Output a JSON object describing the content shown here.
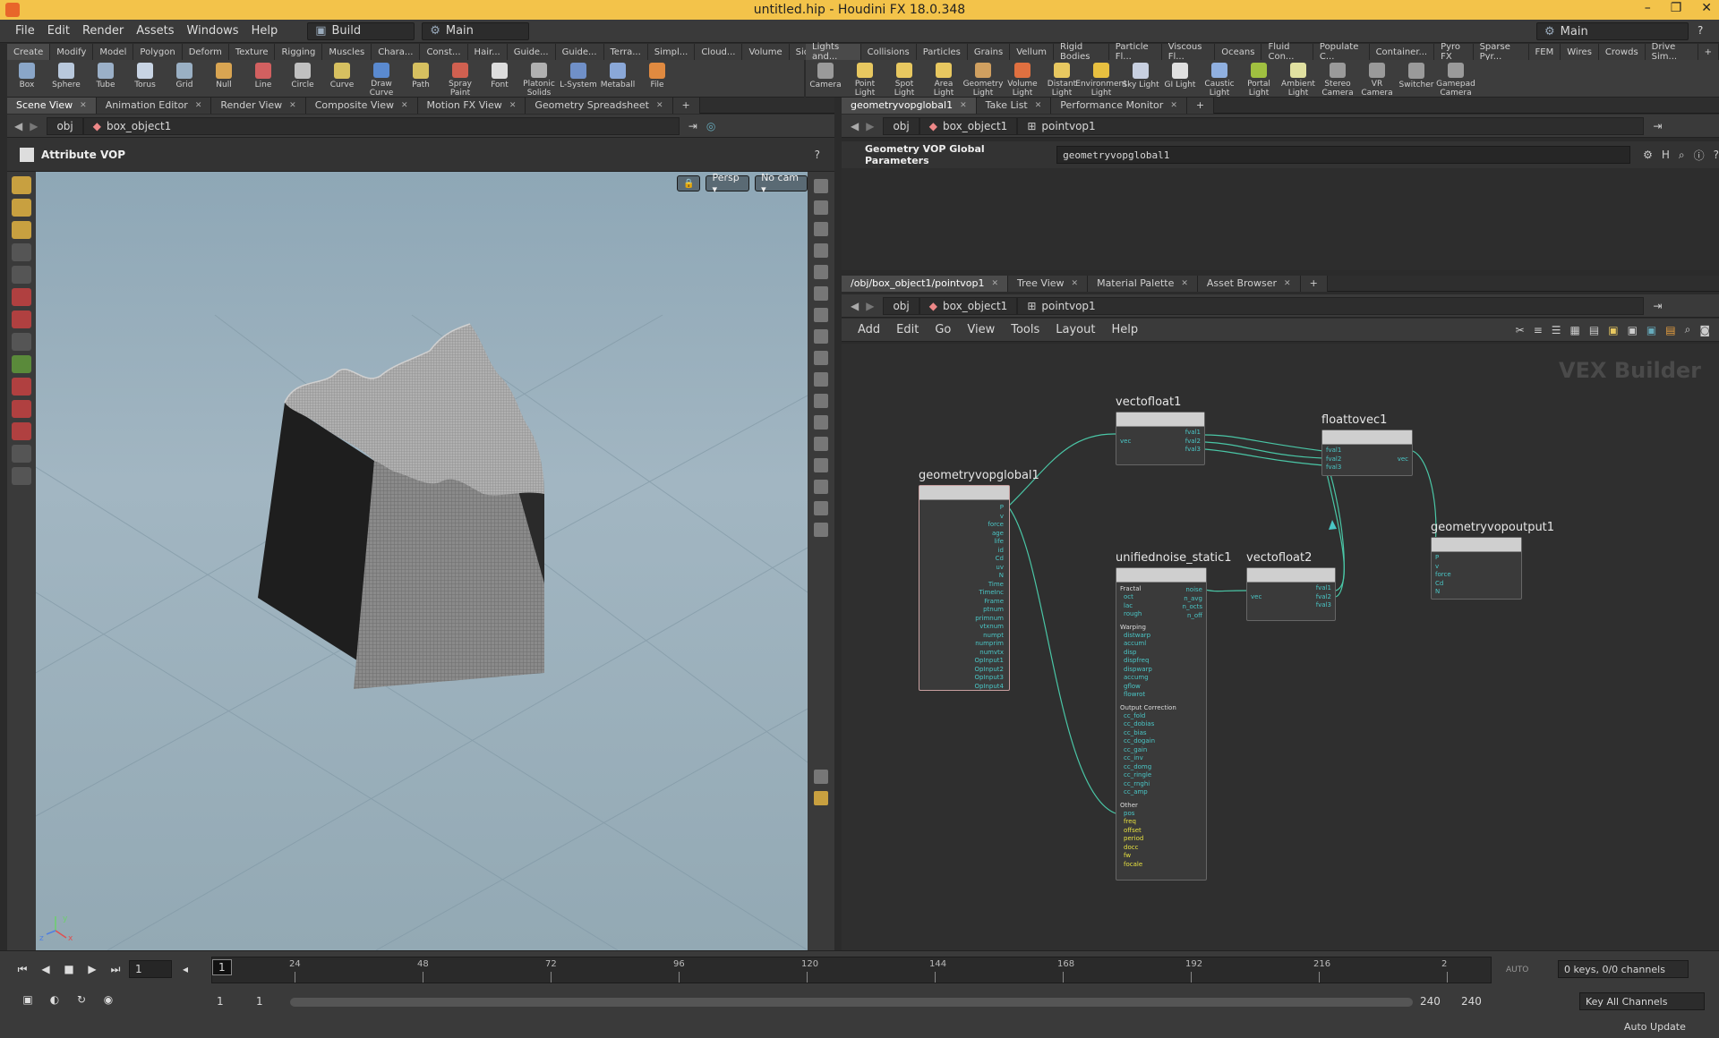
{
  "window": {
    "title": "untitled.hip - Houdini FX 18.0.348",
    "min": "–",
    "max": "❐",
    "close": "✕"
  },
  "menubar": {
    "items": [
      "File",
      "Edit",
      "Render",
      "Assets",
      "Windows",
      "Help"
    ],
    "desktop_left": "Build",
    "desktop_center": "Main",
    "desktop_right": "Main",
    "help_icon": "?"
  },
  "shelf_left": {
    "tabs": [
      "Create",
      "Modify",
      "Model",
      "Polygon",
      "Deform",
      "Texture",
      "Rigging",
      "Muscles",
      "Chara...",
      "Const...",
      "Hair...",
      "Guide...",
      "Guide...",
      "Terra...",
      "Simpl...",
      "Cloud...",
      "Volume",
      "SideF..."
    ],
    "tools": [
      {
        "label": "Box",
        "icon": "box-icon",
        "color": "#8aa6c8"
      },
      {
        "label": "Sphere",
        "icon": "sphere-icon",
        "color": "#b8c8dc"
      },
      {
        "label": "Tube",
        "icon": "tube-icon",
        "color": "#9bb0c8"
      },
      {
        "label": "Torus",
        "icon": "torus-icon",
        "color": "#c8d4e4"
      },
      {
        "label": "Grid",
        "icon": "grid-icon",
        "color": "#9ab0c4"
      },
      {
        "label": "Null",
        "icon": "null-icon",
        "color": "#d9a552"
      },
      {
        "label": "Line",
        "icon": "line-icon",
        "color": "#d26060"
      },
      {
        "label": "Circle",
        "icon": "circle-icon",
        "color": "#c0c0c0"
      },
      {
        "label": "Curve",
        "icon": "curve-icon",
        "color": "#d6c060"
      },
      {
        "label": "Draw Curve",
        "icon": "draw-curve-icon",
        "color": "#5a8ad0"
      },
      {
        "label": "Path",
        "icon": "path-icon",
        "color": "#d6c060"
      },
      {
        "label": "Spray Paint",
        "icon": "spray-paint-icon",
        "color": "#d06050"
      },
      {
        "label": "Font",
        "icon": "font-icon",
        "color": "#dddddd"
      },
      {
        "label": "Platonic Solids",
        "icon": "platonic-icon",
        "color": "#b0b0b0"
      },
      {
        "label": "L-System",
        "icon": "lsystem-icon",
        "color": "#7090c8"
      },
      {
        "label": "Metaball",
        "icon": "metaball-icon",
        "color": "#8aa8d8"
      },
      {
        "label": "File",
        "icon": "file-icon",
        "color": "#e08a40"
      }
    ]
  },
  "shelf_right": {
    "tabs": [
      "Lights and...",
      "Collisions",
      "Particles",
      "Grains",
      "Vellum",
      "Rigid Bodies",
      "Particle Fl...",
      "Viscous Fl...",
      "Oceans",
      "Fluid Con...",
      "Populate C...",
      "Container...",
      "Pyro FX",
      "Sparse Pyr...",
      "FEM",
      "Wires",
      "Crowds",
      "Drive Sim..."
    ],
    "tools": [
      {
        "label": "Camera",
        "icon": "camera-icon",
        "color": "#9a9a9a"
      },
      {
        "label": "Point Light",
        "icon": "point-light-icon",
        "color": "#e8c860"
      },
      {
        "label": "Spot Light",
        "icon": "spot-light-icon",
        "color": "#e8c860"
      },
      {
        "label": "Area Light",
        "icon": "area-light-icon",
        "color": "#e8c860"
      },
      {
        "label": "Geometry Light",
        "icon": "geometry-light-icon",
        "color": "#d0a060"
      },
      {
        "label": "Volume Light",
        "icon": "volume-light-icon",
        "color": "#e07040"
      },
      {
        "label": "Distant Light",
        "icon": "distant-light-icon",
        "color": "#e8c860"
      },
      {
        "label": "Environment Light",
        "icon": "environment-light-icon",
        "color": "#e8c040"
      },
      {
        "label": "Sky Light",
        "icon": "sky-light-icon",
        "color": "#c8d0e0"
      },
      {
        "label": "GI Light",
        "icon": "gi-light-icon",
        "color": "#e0e0e0"
      },
      {
        "label": "Caustic Light",
        "icon": "caustic-light-icon",
        "color": "#90b0e0"
      },
      {
        "label": "Portal Light",
        "icon": "portal-light-icon",
        "color": "#a0c040"
      },
      {
        "label": "Ambient Light",
        "icon": "ambient-light-icon",
        "color": "#e0e0a0"
      },
      {
        "label": "Stereo Camera",
        "icon": "stereo-camera-icon",
        "color": "#9a9a9a"
      },
      {
        "label": "VR Camera",
        "icon": "vr-camera-icon",
        "color": "#9a9a9a"
      },
      {
        "label": "Switcher",
        "icon": "switcher-icon",
        "color": "#9a9a9a"
      },
      {
        "label": "Gamepad Camera",
        "icon": "gamepad-camera-icon",
        "color": "#9a9a9a"
      }
    ]
  },
  "left_pane": {
    "tabs": [
      "Scene View",
      "Animation Editor",
      "Render View",
      "Composite View",
      "Motion FX View",
      "Geometry Spreadsheet"
    ],
    "path": {
      "obj": "obj",
      "node": "box_object1"
    },
    "operator_title": "Attribute VOP",
    "viewport": {
      "persp": "Persp ▾",
      "cam": "No cam ▾",
      "axis_labels": [
        "x",
        "y",
        "z"
      ]
    }
  },
  "param_pane": {
    "tabs": [
      "geometryvopglobal1",
      "Take List",
      "Performance Monitor"
    ],
    "path": {
      "obj": "obj",
      "node": "box_object1",
      "sub": "pointvop1"
    },
    "header_label": "Geometry VOP Global Parameters",
    "header_value": "geometryvopglobal1"
  },
  "network_pane": {
    "tabs": [
      "/obj/box_object1/pointvop1",
      "Tree View",
      "Material Palette",
      "Asset Browser"
    ],
    "path": {
      "obj": "obj",
      "node": "box_object1",
      "sub": "pointvop1"
    },
    "menu": [
      "Add",
      "Edit",
      "Go",
      "View",
      "Tools",
      "Layout",
      "Help"
    ],
    "watermark": "VEX Builder",
    "nodes": {
      "global": {
        "name": "geometryvopglobal1",
        "outputs": [
          "P",
          "v",
          "force",
          "age",
          "life",
          "id",
          "Cd",
          "uv",
          "N",
          "Time",
          "TimeInc",
          "Frame",
          "ptnum",
          "primnum",
          "vtxnum",
          "numpt",
          "numprim",
          "numvtx",
          "OpInput1",
          "OpInput2",
          "OpInput3",
          "OpInput4"
        ]
      },
      "vtof": {
        "name": "vectofloat1",
        "inputs": [
          "vec"
        ],
        "outputs": [
          "fval1",
          "fval2",
          "fval3"
        ]
      },
      "ftov": {
        "name": "floattovec1",
        "inputs": [
          "fval1",
          "fval2",
          "fval3"
        ],
        "outputs": [
          "vec"
        ]
      },
      "output": {
        "name": "geometryvopoutput1",
        "inputs": [
          "P",
          "v",
          "force",
          "Cd",
          "N"
        ]
      },
      "noise": {
        "name": "unifiednoise_static1",
        "outputs": [
          "noise",
          "n_avg",
          "n_octs",
          "n_off"
        ],
        "sections": [
          {
            "title": "Fractal",
            "ports": [
              "oct",
              "lac",
              "rough"
            ]
          },
          {
            "title": "Warping",
            "ports": [
              "distwarp",
              "accuml",
              "disp",
              "dispfreq",
              "dispwarp",
              "accumg",
              "gflow",
              "flowrot"
            ]
          },
          {
            "title": "Output Correction",
            "ports": [
              "cc_fold",
              "cc_dobias",
              "cc_bias",
              "cc_dogain",
              "cc_gain",
              "cc_inv",
              "cc_domg",
              "cc_ringle",
              "cc_rnghi",
              "cc_amp"
            ]
          },
          {
            "title": "Other",
            "ports": [
              "pos",
              "freq",
              "offset",
              "period",
              "docc",
              "fw",
              "focale"
            ]
          }
        ]
      },
      "vtof2": {
        "name": "vectofloat2",
        "inputs": [
          "vec"
        ],
        "outputs": [
          "fval1",
          "fval2",
          "fval3"
        ]
      }
    }
  },
  "timeline": {
    "frame": "1",
    "ticks": [
      "24",
      "48",
      "72",
      "96",
      "120",
      "144",
      "168",
      "192",
      "216",
      "2"
    ],
    "current_marker": "1",
    "range_start": "1",
    "range_start2": "1",
    "range_end": "240",
    "range_end2": "240",
    "keys_info": "0 keys, 0/0 channels",
    "key_all": "Key All Channels",
    "auto_update": "Auto Update",
    "auto_label": "AUTO"
  }
}
